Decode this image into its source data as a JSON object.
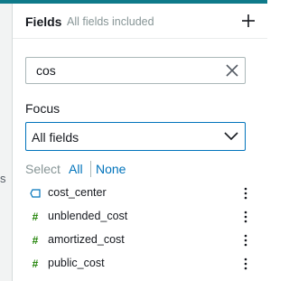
{
  "left_gutter": {
    "label": "s"
  },
  "header": {
    "title": "Fields",
    "subtitle": "All fields included",
    "add_icon": "plus-icon"
  },
  "search": {
    "value": "cos",
    "placeholder": "",
    "clear_icon": "close-icon"
  },
  "focus": {
    "label": "Focus",
    "selected": "All fields",
    "chevron_icon": "chevron-down-icon"
  },
  "select": {
    "label": "Select",
    "all": "All",
    "none": "None"
  },
  "fields": [
    {
      "name": "cost_center",
      "type": "dimension",
      "icon": "dimension-tag-icon"
    },
    {
      "name": "unblended_cost",
      "type": "measure",
      "icon": "measure-hash-icon"
    },
    {
      "name": "amortized_cost",
      "type": "measure",
      "icon": "measure-hash-icon"
    },
    {
      "name": "public_cost",
      "type": "measure",
      "icon": "measure-hash-icon"
    }
  ],
  "colors": {
    "accent_top": "#0f7a8a",
    "link": "#0073bb",
    "dimension_icon": "#0073bb",
    "measure_icon": "#1d8102"
  }
}
